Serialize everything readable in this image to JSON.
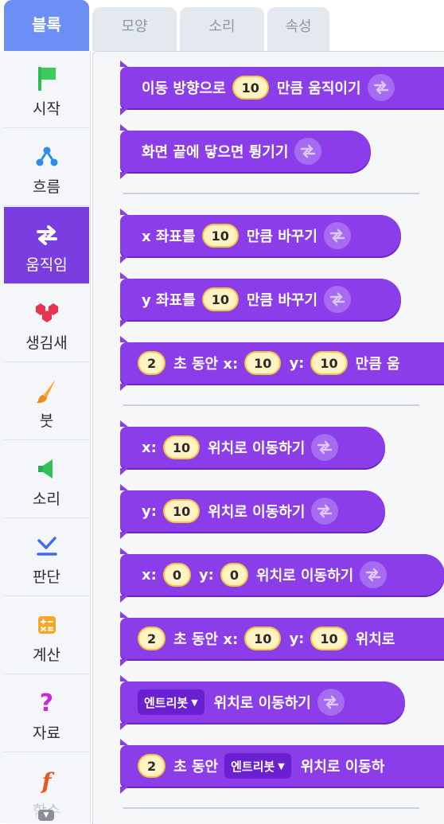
{
  "tabs": [
    {
      "label": "블록"
    },
    {
      "label": "모양"
    },
    {
      "label": "소리"
    },
    {
      "label": "속성"
    }
  ],
  "categories": [
    {
      "label": "시작",
      "icon": "flag-icon"
    },
    {
      "label": "흐름",
      "icon": "flow-icon"
    },
    {
      "label": "움직임",
      "icon": "move-arrows-icon"
    },
    {
      "label": "생김새",
      "icon": "shapes-icon"
    },
    {
      "label": "붓",
      "icon": "brush-icon"
    },
    {
      "label": "소리",
      "icon": "speaker-icon"
    },
    {
      "label": "판단",
      "icon": "check-icon"
    },
    {
      "label": "계산",
      "icon": "calculator-icon"
    },
    {
      "label": "자료",
      "icon": "question-icon"
    },
    {
      "label": "함수",
      "icon": "function-icon"
    }
  ],
  "active_category": "움직임",
  "colors": {
    "accent": "#6b8ff5",
    "block": "#8a3de8",
    "category_active": "#7a3de0",
    "input_fill": "#fff2c3",
    "input_border": "#f4c53e"
  },
  "blocks": {
    "b1": {
      "t1": "이동 방향으로",
      "v1": "10",
      "t2": "만큼 움직이기"
    },
    "b2": {
      "t1": "화면 끝에 닿으면 튕기기"
    },
    "b3": {
      "t1": "x 좌표를",
      "v1": "10",
      "t2": "만큼 바꾸기"
    },
    "b4": {
      "t1": "y 좌표를",
      "v1": "10",
      "t2": "만큼 바꾸기"
    },
    "b5": {
      "v1": "2",
      "t1": "초 동안 x:",
      "v2": "10",
      "t2": "y:",
      "v3": "10",
      "t3": "만큼 움"
    },
    "b6": {
      "t1": "x:",
      "v1": "10",
      "t2": "위치로 이동하기"
    },
    "b7": {
      "t1": "y:",
      "v1": "10",
      "t2": "위치로 이동하기"
    },
    "b8": {
      "t1": "x:",
      "v1": "0",
      "t2": "y:",
      "v2": "0",
      "t3": "위치로 이동하기"
    },
    "b9": {
      "v1": "2",
      "t1": "초 동안 x:",
      "v2": "10",
      "t2": "y:",
      "v3": "10",
      "t3": "위치로"
    },
    "b10": {
      "d1": "엔트리봇",
      "t1": "위치로 이동하기"
    },
    "b11": {
      "v1": "2",
      "t1": "초 동안",
      "d1": "엔트리봇",
      "t2": "위치로 이동하"
    }
  }
}
